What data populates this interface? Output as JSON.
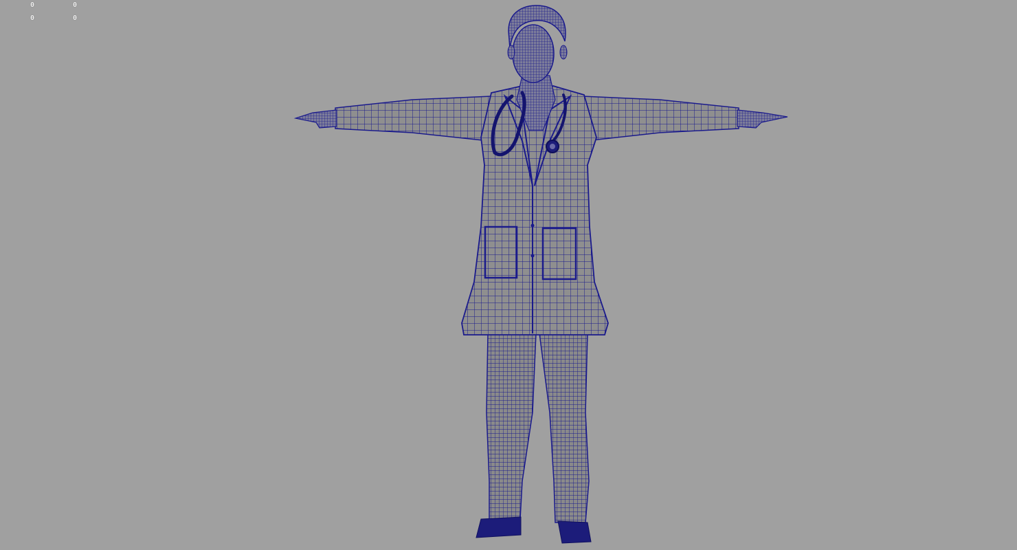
{
  "hud": {
    "row1_col1": "0",
    "row1_col2": "0",
    "row2_col1": "0",
    "row2_col2": "0"
  },
  "viewport": {
    "background_color": "#a0a0a0",
    "wireframe_color": "#1a1a8c",
    "surface_color": "#8f8f8f",
    "shoe_color": "#1c1c7a"
  },
  "model": {
    "pose": "T-pose",
    "display_mode": "wireframe-on-shaded"
  }
}
